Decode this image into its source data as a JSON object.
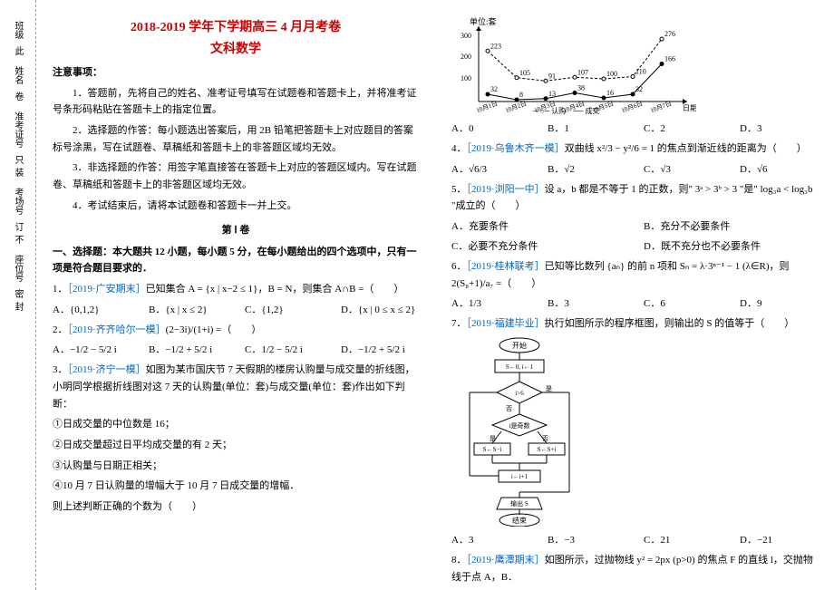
{
  "binding": {
    "a": "班级",
    "b": "姓名",
    "c": "准考证号",
    "d": "考场号",
    "e": "座位号",
    "m1": "此",
    "m2": "卷",
    "m3": "只",
    "m4": "装",
    "m5": "订",
    "m6": "不",
    "m7": "密",
    "m8": "封"
  },
  "title1": "2018-2019 学年下学期高三 4 月月考卷",
  "title2": "文科数学",
  "notice_h": "注意事项：",
  "n1": "1．答题前，先将自己的姓名、准考证号填写在试题卷和答题卡上，并将准考证号条形码粘贴在答题卡上的指定位置。",
  "n2": "2．选择题的作答：每小题选出答案后，用 2B 铅笔把答题卡上对应题目的答案标号涂黑，写在试题卷、草稿纸和答题卡上的非答题区域均无效。",
  "n3": "3．非选择题的作答：用签字笔直接答在答题卡上对应的答题区域内。写在试题卷、草稿纸和答题卡上的非答题区域均无效。",
  "n4": "4．考试结束后，请将本试题卷和答题卡一并上交。",
  "part1": "第 Ⅰ 卷",
  "sec1": "一、选择题：本大题共 12 小题，每小题 5 分，在每小题给出的四个选项中，只有一项是符合题目要求的．",
  "q1": {
    "src": "［2019·广安期末］",
    "stem": "已知集合 A = {x | x−2 ≤ 1}，B = N，则集合 A∩B =（　　）",
    "A": "A．{0,1,2}",
    "B": "B．{x | x ≤ 2}",
    "C": "C．{1,2}",
    "D": "D．{x | 0 ≤ x ≤ 2}"
  },
  "q2": {
    "src": "［2019·齐齐哈尔一模］",
    "stem": "(2−3i)/(1+i) =（　　）",
    "A": "A．−1/2 − 5/2 i",
    "B": "B．−1/2 + 5/2 i",
    "C": "C．1/2 − 5/2 i",
    "D": "D．−1/2 + 5/2 i"
  },
  "q3": {
    "src": "［2019·济宁一模］",
    "stem": "如图为某市国庆节 7 天假期的楼房认购量与成交量的折线图，小明同学根据折线图对这 7 天的认购量(单位：套)与成交量(单位：套)作出如下判断：",
    "s1": "①日成交量的中位数是 16；",
    "s2": "②日成交量超过日平均成交量的有 2 天；",
    "s3": "③认购量与日期正相关；",
    "s4": "④10 月 7 日认购量的增幅大于 10 月 7 日成交量的增幅．",
    "s5": "则上述判断正确的个数为（　　）"
  },
  "chart_data": {
    "type": "line",
    "xlabel": "日期",
    "ylabel": "单位:套",
    "ylim": [
      0,
      300
    ],
    "categories": [
      "10月1日",
      "10月2日",
      "10月3日",
      "10月4日",
      "10月5日",
      "10月6日",
      "10月7日"
    ],
    "series": [
      {
        "name": "认购",
        "values": [
          223,
          105,
          91,
          107,
          100,
          110,
          276
        ]
      },
      {
        "name": "成交",
        "values": [
          32,
          8,
          13,
          38,
          16,
          32,
          166
        ]
      }
    ],
    "annotations": [
      223,
      276,
      166,
      105,
      91,
      107,
      100,
      110,
      32,
      8,
      13,
      38,
      16,
      32
    ]
  },
  "q3o": {
    "A": "A．0",
    "B": "B．1",
    "C": "C．2",
    "D": "D．3"
  },
  "q4": {
    "src": "［2019·乌鲁木齐一模］",
    "stem": "双曲线 x²/3 − y²/6 = 1 的焦点到渐近线的距离为（　　）",
    "A": "A．√6/3",
    "B": "B．√2",
    "C": "C．√3",
    "D": "D．√6"
  },
  "q5": {
    "src": "［2019·浏阳一中］",
    "stem": "设 a，b 都是不等于 1 的正数，则\" 3ᵃ > 3ᵇ > 3 \"是\" log₃a < log₃b \"成立的（　　）",
    "A": "A．充要条件",
    "B": "B．充分不必要条件",
    "C": "C．必要不充分条件",
    "D": "D．既不充分也不必要条件"
  },
  "q6": {
    "src": "［2019·桂林联考］",
    "stem": "已知等比数列 {aₙ} 的前 n 项和 Sₙ = λ·3ⁿ⁻¹ − 1 (λ∈R)，则 2(S₈+1)/a₇ =（　　）",
    "A": "A．1/3",
    "B": "B．3",
    "C": "C．6",
    "D": "D．9"
  },
  "q7": {
    "src": "［2019·福建毕业］",
    "stem": "执行如图所示的程序框图，则输出的 S 的值等于（　　）",
    "A": "A．3",
    "B": "B．−3",
    "C": "C．21",
    "D": "D．−21"
  },
  "flow": {
    "start": "开始",
    "init": "S←0, i←1",
    "cond": "i>6",
    "odd": "i是奇数",
    "op1": "S←S−i",
    "op2": "S←S+i",
    "inc": "i←i+1",
    "out": "输出 S",
    "end": "结束",
    "yes": "是",
    "no": "否"
  },
  "q8": {
    "src": "［2019·鹰潭期末］",
    "stem": "如图所示，过抛物线 y² = 2px (p>0) 的焦点 F 的直线 l，交抛物线于点 A，B．"
  }
}
